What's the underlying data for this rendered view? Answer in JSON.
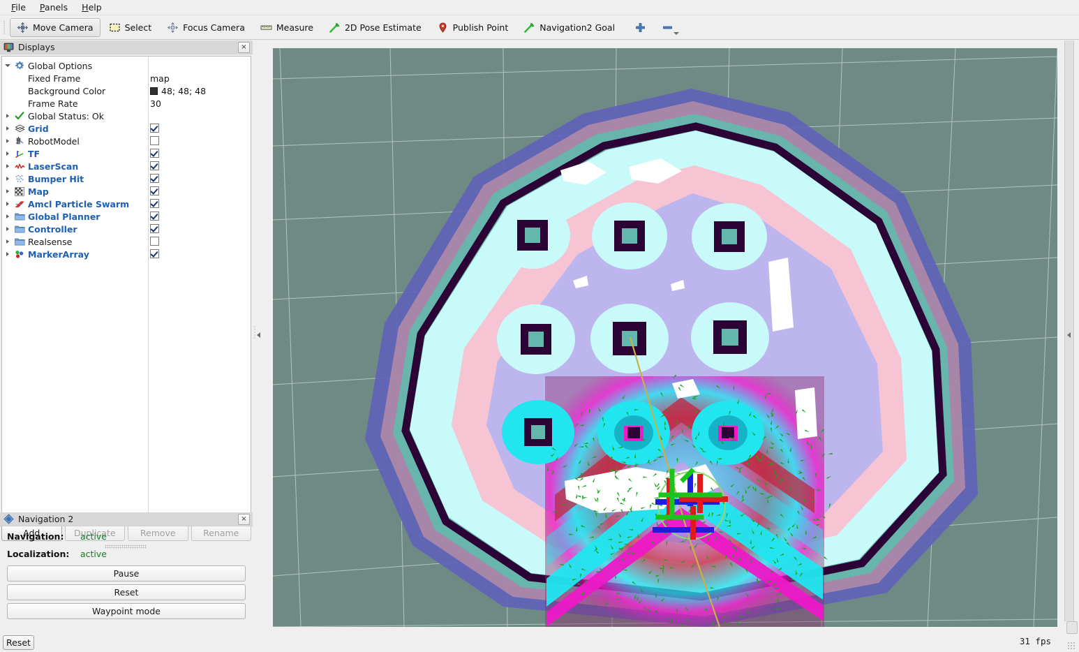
{
  "menu": {
    "items": [
      {
        "label": "File",
        "accel": "F"
      },
      {
        "label": "Panels",
        "accel": "P"
      },
      {
        "label": "Help",
        "accel": "H"
      }
    ]
  },
  "toolbar": {
    "tools": [
      {
        "label": "Move Camera",
        "icon": "move-camera-icon",
        "checked": true
      },
      {
        "label": "Select",
        "icon": "select-icon",
        "checked": false
      },
      {
        "label": "Focus Camera",
        "icon": "focus-camera-icon",
        "checked": false
      },
      {
        "label": "Measure",
        "icon": "measure-ruler-icon",
        "checked": false
      },
      {
        "label": "2D Pose Estimate",
        "icon": "pose-arrow-icon",
        "checked": false
      },
      {
        "label": "Publish Point",
        "icon": "map-pin-icon",
        "checked": false
      },
      {
        "label": "Navigation2 Goal",
        "icon": "goal-arrow-icon",
        "checked": false
      }
    ],
    "add_tool_icon": "plus-icon",
    "remove_tool_icon": "minus-icon"
  },
  "displays_panel": {
    "title": "Displays",
    "icon": "displays-monitor-icon",
    "close_label": "×",
    "tree": [
      {
        "label": "Global Options",
        "icon": "gear-icon",
        "expander": "open",
        "style": "plain",
        "control": "none"
      },
      {
        "label": "Fixed Frame",
        "icon": "none",
        "expander": "none",
        "style": "plain",
        "control": "text",
        "value": "map",
        "indent": 34
      },
      {
        "label": "Background Color",
        "icon": "none",
        "expander": "none",
        "style": "plain",
        "control": "color",
        "value": "48; 48; 48",
        "swatch": "#303030",
        "indent": 34
      },
      {
        "label": "Frame Rate",
        "icon": "none",
        "expander": "none",
        "style": "plain",
        "control": "text",
        "value": "30",
        "indent": 34
      },
      {
        "label": "Global Status: Ok",
        "icon": "check-ok-icon",
        "expander": "closed",
        "style": "plain",
        "control": "none"
      },
      {
        "label": "Grid",
        "icon": "grid-icon",
        "expander": "closed",
        "style": "blue",
        "control": "checkbox",
        "checked": true
      },
      {
        "label": "RobotModel",
        "icon": "robot-model-icon",
        "expander": "closed",
        "style": "plain",
        "control": "checkbox",
        "checked": false
      },
      {
        "label": "TF",
        "icon": "tf-axes-icon",
        "expander": "closed",
        "style": "blue",
        "control": "checkbox",
        "checked": true
      },
      {
        "label": "LaserScan",
        "icon": "laserscan-icon",
        "expander": "closed",
        "style": "blue",
        "control": "checkbox",
        "checked": true
      },
      {
        "label": "Bumper Hit",
        "icon": "pointcloud-icon",
        "expander": "closed",
        "style": "blue",
        "control": "checkbox",
        "checked": true
      },
      {
        "label": "Map",
        "icon": "map-grid-icon",
        "expander": "closed",
        "style": "blue",
        "control": "checkbox",
        "checked": true
      },
      {
        "label": "Amcl Particle Swarm",
        "icon": "pose-array-icon",
        "expander": "closed",
        "style": "blue",
        "control": "checkbox",
        "checked": true
      },
      {
        "label": "Global Planner",
        "icon": "folder-icon",
        "expander": "closed",
        "style": "blue",
        "control": "checkbox",
        "checked": true
      },
      {
        "label": "Controller",
        "icon": "folder-icon",
        "expander": "closed",
        "style": "blue",
        "control": "checkbox",
        "checked": true
      },
      {
        "label": "Realsense",
        "icon": "folder-icon",
        "expander": "closed",
        "style": "plain",
        "control": "checkbox",
        "checked": false
      },
      {
        "label": "MarkerArray",
        "icon": "marker-array-icon",
        "expander": "closed",
        "style": "blue",
        "control": "checkbox",
        "checked": true
      }
    ],
    "buttons": [
      {
        "label": "Add",
        "enabled": true
      },
      {
        "label": "Duplicate",
        "enabled": false
      },
      {
        "label": "Remove",
        "enabled": false
      },
      {
        "label": "Rename",
        "enabled": false
      }
    ]
  },
  "navigation_panel": {
    "title": "Navigation 2",
    "icon": "nav2-diamond-icon",
    "close_label": "×",
    "status": [
      {
        "key": "Navigation:",
        "value": "active"
      },
      {
        "key": "Localization:",
        "value": "active"
      }
    ],
    "buttons": [
      {
        "label": "Pause"
      },
      {
        "label": "Reset"
      },
      {
        "label": "Waypoint mode"
      }
    ]
  },
  "statusbar": {
    "reset_label": "Reset",
    "fps": "31 fps"
  },
  "viewport": {
    "background_color": "#6f8a85",
    "grid_color": "#cfd9d6",
    "costmap": {
      "lethal": "#2b0334",
      "free_inner": "#c8fafa",
      "inflation_pink": "#f7c4d4",
      "inflation_lavender": "#bdb6ee",
      "inflation_blue": "#5f63b8",
      "teal": "#63b7ac",
      "local_cyan": "#21e6f0",
      "local_magenta": "#f318c8",
      "local_red": "#c8263f",
      "local_purple": "#7b3b9a",
      "unknown_white": "#ffffff"
    },
    "robot": {
      "axis_x": "#e01b1b",
      "axis_y": "#1bc41b",
      "axis_z": "#1d1ddd",
      "particles": "#17a317",
      "path": "#c2b24c",
      "footprint": "#8fd96b"
    }
  }
}
